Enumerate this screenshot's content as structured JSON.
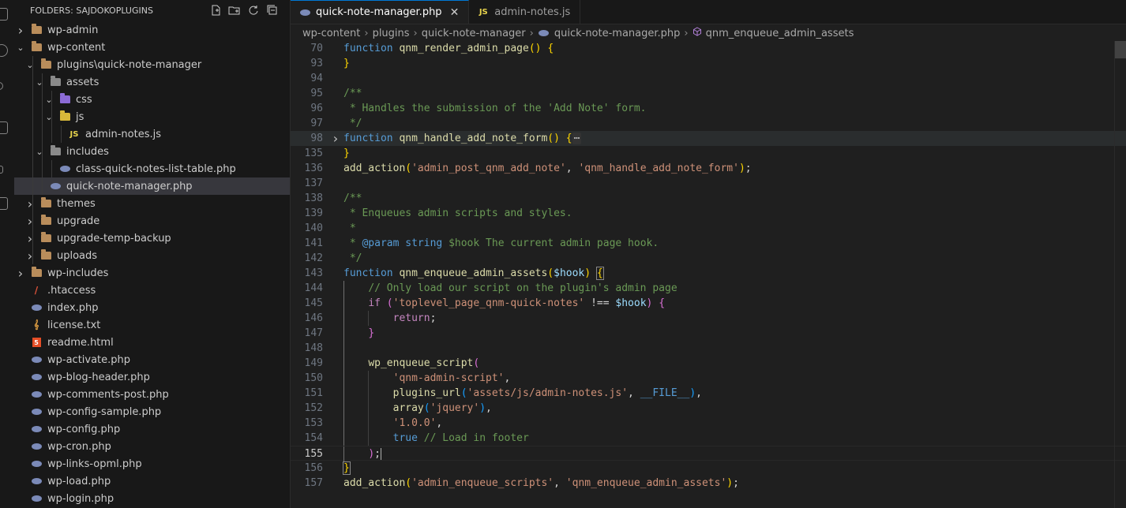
{
  "explorer": {
    "header": "FOLDERS: SAJDOKOPLUGINS",
    "tree": [
      {
        "label": "wp-admin",
        "depth": 0,
        "type": "folder",
        "chevron": "›",
        "icon": "folder"
      },
      {
        "label": "wp-content",
        "depth": 0,
        "type": "folder",
        "chevron": "⌄",
        "icon": "folder"
      },
      {
        "label": "plugins\\quick-note-manager",
        "depth": 1,
        "type": "folder",
        "chevron": "⌄",
        "icon": "folder"
      },
      {
        "label": "assets",
        "depth": 2,
        "type": "folder",
        "chevron": "⌄",
        "icon": "folder-grey"
      },
      {
        "label": "css",
        "depth": 3,
        "type": "folder",
        "chevron": "⌄",
        "icon": "folder-purple"
      },
      {
        "label": "js",
        "depth": 3,
        "type": "folder",
        "chevron": "⌄",
        "icon": "folder-yellow"
      },
      {
        "label": "admin-notes.js",
        "depth": 4,
        "type": "file",
        "icon": "js"
      },
      {
        "label": "includes",
        "depth": 2,
        "type": "folder",
        "chevron": "⌄",
        "icon": "folder-grey"
      },
      {
        "label": "class-quick-notes-list-table.php",
        "depth": 3,
        "type": "file",
        "icon": "php"
      },
      {
        "label": "quick-note-manager.php",
        "depth": 2,
        "type": "file",
        "icon": "php",
        "selected": true
      },
      {
        "label": "themes",
        "depth": 1,
        "type": "folder",
        "chevron": "›",
        "icon": "folder"
      },
      {
        "label": "upgrade",
        "depth": 1,
        "type": "folder",
        "chevron": "›",
        "icon": "folder"
      },
      {
        "label": "upgrade-temp-backup",
        "depth": 1,
        "type": "folder",
        "chevron": "›",
        "icon": "folder"
      },
      {
        "label": "uploads",
        "depth": 1,
        "type": "folder",
        "chevron": "›",
        "icon": "folder"
      },
      {
        "label": "wp-includes",
        "depth": 0,
        "type": "folder",
        "chevron": "›",
        "icon": "folder"
      },
      {
        "label": ".htaccess",
        "depth": 0,
        "type": "file",
        "icon": "htaccess"
      },
      {
        "label": "index.php",
        "depth": 0,
        "type": "file",
        "icon": "php"
      },
      {
        "label": "license.txt",
        "depth": 0,
        "type": "file",
        "icon": "txt"
      },
      {
        "label": "readme.html",
        "depth": 0,
        "type": "file",
        "icon": "html"
      },
      {
        "label": "wp-activate.php",
        "depth": 0,
        "type": "file",
        "icon": "php"
      },
      {
        "label": "wp-blog-header.php",
        "depth": 0,
        "type": "file",
        "icon": "php"
      },
      {
        "label": "wp-comments-post.php",
        "depth": 0,
        "type": "file",
        "icon": "php"
      },
      {
        "label": "wp-config-sample.php",
        "depth": 0,
        "type": "file",
        "icon": "php"
      },
      {
        "label": "wp-config.php",
        "depth": 0,
        "type": "file",
        "icon": "php"
      },
      {
        "label": "wp-cron.php",
        "depth": 0,
        "type": "file",
        "icon": "php"
      },
      {
        "label": "wp-links-opml.php",
        "depth": 0,
        "type": "file",
        "icon": "php"
      },
      {
        "label": "wp-load.php",
        "depth": 0,
        "type": "file",
        "icon": "php"
      },
      {
        "label": "wp-login.php",
        "depth": 0,
        "type": "file",
        "icon": "php"
      }
    ]
  },
  "tabs": [
    {
      "label": "quick-note-manager.php",
      "icon": "php",
      "active": true
    },
    {
      "label": "admin-notes.js",
      "icon": "js",
      "active": false
    }
  ],
  "icons": {
    "js_glyph": "JS",
    "html_glyph": "5",
    "close_glyph": "✕",
    "ellipsis": "⋯"
  },
  "breadcrumb": [
    "wp-content",
    "plugins",
    "quick-note-manager",
    "quick-note-manager.php",
    "qnm_enqueue_admin_assets"
  ],
  "code": {
    "current_line": "155",
    "lines": [
      {
        "n": "70",
        "t": [
          [
            "k",
            "function "
          ],
          [
            "fn",
            "qnm_render_admin_page"
          ],
          [
            "b1",
            "()"
          ],
          [
            "p",
            " "
          ],
          [
            "b1",
            "{"
          ]
        ]
      },
      {
        "n": "93",
        "t": [
          [
            "b1",
            "}"
          ]
        ]
      },
      {
        "n": "94",
        "t": []
      },
      {
        "n": "95",
        "t": [
          [
            "c",
            "/**"
          ]
        ]
      },
      {
        "n": "96",
        "t": [
          [
            "c",
            " * Handles the submission of the 'Add Note' form."
          ]
        ]
      },
      {
        "n": "97",
        "t": [
          [
            "c",
            " */"
          ]
        ]
      },
      {
        "n": "98",
        "fold": true,
        "hl": true,
        "t": [
          [
            "k",
            "function "
          ],
          [
            "fn",
            "qnm_handle_add_note_form"
          ],
          [
            "b1",
            "()"
          ],
          [
            "p",
            " "
          ],
          [
            "b1",
            "{"
          ],
          [
            "ell",
            "⋯"
          ]
        ]
      },
      {
        "n": "135",
        "t": [
          [
            "b1",
            "}"
          ]
        ]
      },
      {
        "n": "136",
        "t": [
          [
            "fn",
            "add_action"
          ],
          [
            "b1",
            "("
          ],
          [
            "s",
            "'admin_post_qnm_add_note'"
          ],
          [
            "p",
            ", "
          ],
          [
            "s",
            "'qnm_handle_add_note_form'"
          ],
          [
            "b1",
            ")"
          ],
          [
            "p",
            ";"
          ]
        ]
      },
      {
        "n": "137",
        "t": []
      },
      {
        "n": "138",
        "t": [
          [
            "c",
            "/**"
          ]
        ]
      },
      {
        "n": "139",
        "t": [
          [
            "c",
            " * Enqueues admin scripts and styles."
          ]
        ]
      },
      {
        "n": "140",
        "t": [
          [
            "c",
            " *"
          ]
        ]
      },
      {
        "n": "141",
        "t": [
          [
            "c",
            " * "
          ],
          [
            "tag",
            "@param"
          ],
          [
            "c",
            " "
          ],
          [
            "k",
            "string"
          ],
          [
            "c",
            " $hook The current admin page hook."
          ]
        ]
      },
      {
        "n": "142",
        "t": [
          [
            "c",
            " */"
          ]
        ]
      },
      {
        "n": "143",
        "t": [
          [
            "k",
            "function "
          ],
          [
            "fn",
            "qnm_enqueue_admin_assets"
          ],
          [
            "b1",
            "("
          ],
          [
            "v",
            "$hook"
          ],
          [
            "b1",
            ")"
          ],
          [
            "p",
            " "
          ],
          [
            "b1 ubox",
            "{"
          ]
        ]
      },
      {
        "n": "144",
        "g": 1,
        "t": [
          [
            "p",
            "    "
          ],
          [
            "c",
            "// Only load our script on the plugin's admin page"
          ]
        ]
      },
      {
        "n": "145",
        "g": 1,
        "t": [
          [
            "p",
            "    "
          ],
          [
            "ctl",
            "if "
          ],
          [
            "b2",
            "("
          ],
          [
            "s",
            "'toplevel_page_qnm-quick-notes'"
          ],
          [
            "p",
            " !== "
          ],
          [
            "v",
            "$hook"
          ],
          [
            "b2",
            ")"
          ],
          [
            "p",
            " "
          ],
          [
            "b2",
            "{"
          ]
        ]
      },
      {
        "n": "146",
        "g": 2,
        "t": [
          [
            "p",
            "        "
          ],
          [
            "ctl",
            "return"
          ],
          [
            "p",
            ";"
          ]
        ]
      },
      {
        "n": "147",
        "g": 1,
        "t": [
          [
            "p",
            "    "
          ],
          [
            "b2",
            "}"
          ]
        ]
      },
      {
        "n": "148",
        "g": 1,
        "t": []
      },
      {
        "n": "149",
        "g": 1,
        "t": [
          [
            "p",
            "    "
          ],
          [
            "fn",
            "wp_enqueue_script"
          ],
          [
            "b2",
            "("
          ]
        ]
      },
      {
        "n": "150",
        "g": 2,
        "t": [
          [
            "p",
            "        "
          ],
          [
            "s",
            "'qnm-admin-script'"
          ],
          [
            "p",
            ","
          ]
        ]
      },
      {
        "n": "151",
        "g": 2,
        "t": [
          [
            "p",
            "        "
          ],
          [
            "fn",
            "plugins_url"
          ],
          [
            "b3",
            "("
          ],
          [
            "s",
            "'assets/js/admin-notes.js'"
          ],
          [
            "p",
            ", "
          ],
          [
            "k",
            "__FILE__"
          ],
          [
            "b3",
            ")"
          ],
          [
            "p",
            ","
          ]
        ]
      },
      {
        "n": "152",
        "g": 2,
        "t": [
          [
            "p",
            "        "
          ],
          [
            "fn",
            "array"
          ],
          [
            "b3",
            "("
          ],
          [
            "s",
            "'jquery'"
          ],
          [
            "b3",
            ")"
          ],
          [
            "p",
            ","
          ]
        ]
      },
      {
        "n": "153",
        "g": 2,
        "t": [
          [
            "p",
            "        "
          ],
          [
            "s",
            "'1.0.0'"
          ],
          [
            "p",
            ","
          ]
        ]
      },
      {
        "n": "154",
        "g": 2,
        "t": [
          [
            "p",
            "        "
          ],
          [
            "k",
            "true"
          ],
          [
            "p",
            " "
          ],
          [
            "c",
            "// Load in footer"
          ]
        ]
      },
      {
        "n": "155",
        "g": 1,
        "cur": true,
        "t": [
          [
            "p",
            "    "
          ],
          [
            "b2",
            ")"
          ],
          [
            "p",
            ";"
          ]
        ]
      },
      {
        "n": "156",
        "t": [
          [
            "b1 ubox",
            "}"
          ]
        ]
      },
      {
        "n": "157",
        "t": [
          [
            "fn",
            "add_action"
          ],
          [
            "b1",
            "("
          ],
          [
            "s",
            "'admin_enqueue_scripts'"
          ],
          [
            "p",
            ", "
          ],
          [
            "s",
            "'qnm_enqueue_admin_assets'"
          ],
          [
            "b1",
            ")"
          ],
          [
            "p",
            ";"
          ]
        ]
      }
    ]
  }
}
